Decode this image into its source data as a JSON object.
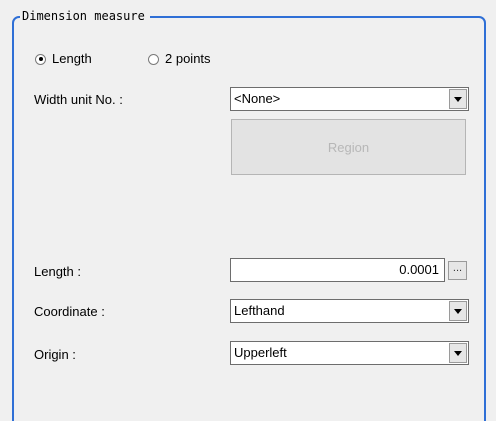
{
  "group": {
    "title": "Dimension measure"
  },
  "mode": {
    "options": [
      {
        "label": "Length",
        "checked": true
      },
      {
        "label": "2 points",
        "checked": false
      }
    ]
  },
  "width_unit": {
    "label": "Width unit No. :",
    "value": "<None>"
  },
  "region_button": {
    "label": "Region",
    "enabled": false
  },
  "length": {
    "label": "Length :",
    "value": "0.0001",
    "button_label": "..."
  },
  "coordinate": {
    "label": "Coordinate :",
    "value": "Lefthand"
  },
  "origin": {
    "label": "Origin :",
    "value": "Upperleft"
  }
}
